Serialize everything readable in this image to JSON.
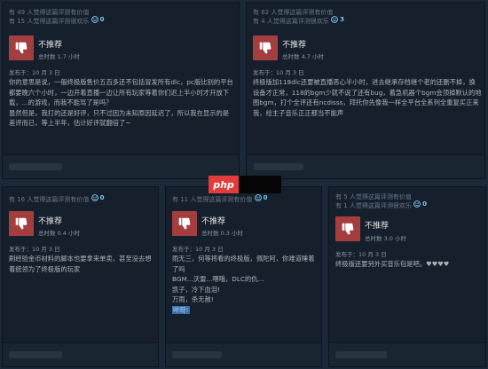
{
  "colors": {
    "thumb_down": "#a43e3e",
    "accent": "#7ec7f2",
    "page_bg": "#1b2838"
  },
  "reviews": [
    {
      "helpful_line1": "有 49 人觉得这篇评测有价值",
      "helpful_line2": "有 15 人觉得这篇评测很欢乐",
      "funny_count": "0",
      "verdict": "不推荐",
      "hours": "总时数 1.7 小时",
      "date": "发布于：10 月 3 日",
      "paragraphs": [
        "你的意思是说，一般终极版售价五百多还不包括冒发所有dlc，pc版比别的平台都要晚六个小时，一边开着直播一边让所有玩家等着你们迟上半小时才开放下载，...的游戏，而我不能骂了是吗？",
        "虽然但是，我打的还是好评，只不过因为未知原因延迟了，所以我在显示的是差评而已，等上半年，估计好评就翻倍了~"
      ]
    },
    {
      "helpful_line1": "有 62 人觉得这篇评测有价值",
      "helpful_line2": "有 4 人觉得这篇评测很欢乐",
      "funny_count": "3",
      "verdict": "不推荐",
      "hours": "总时数 4.7 小时",
      "date": "发布于：10 月 3 日",
      "paragraphs": [
        "终极版加118dlc还要被直播恶心半小时，进去继承存档继个老的还删不掉，换设备才正常，118的bgm少就不说了还有bug，着急机器个bgm会顶掉默认的地图bgm，打个全评还有ncdisss，拜托你先像我一样全平台全系列全重复买正来我，给主子音乐正正都当不能声"
      ]
    },
    {
      "helpful_line1": "有 16 人觉得这篇评测有价值",
      "funny_count": "0",
      "verdict": "不推荐",
      "hours": "总时数 0.4 小时",
      "date": "发布于：10 月 3 日",
      "paragraphs": [
        "刷经验金币材料的脚本也要拿来单卖，甚至没去想着统领为了终极版的玩家"
      ]
    },
    {
      "helpful_line1": "有 11 人觉得这篇评测有价值",
      "funny_count": "0",
      "verdict": "不推荐",
      "hours": "总时数 0.3 小时",
      "date": "发布于：10 月 3 日",
      "paragraphs": [
        "雨无三，何等将看的终极版，佩陀阿，你难道睡着了吗",
        "BGM...沃雷...嘿哦，DLC的仇...",
        "凯子，冷下血泪!",
        "万雨，杀无赦!"
      ],
      "wow": "哔呀!"
    },
    {
      "helpful_line1": "有 5 人觉得这篇评测有价值",
      "helpful_line2": "有 1 人觉得这篇评测很欢乐",
      "funny_count": "0",
      "verdict": "不推荐",
      "hours": "总时数 3.0 小时",
      "date": "发布于：10 月 3 日",
      "paragraphs": [
        "终极版还要另外买音乐包是吧。♥♥♥♥"
      ]
    }
  ],
  "watermark": {
    "text": "php"
  }
}
